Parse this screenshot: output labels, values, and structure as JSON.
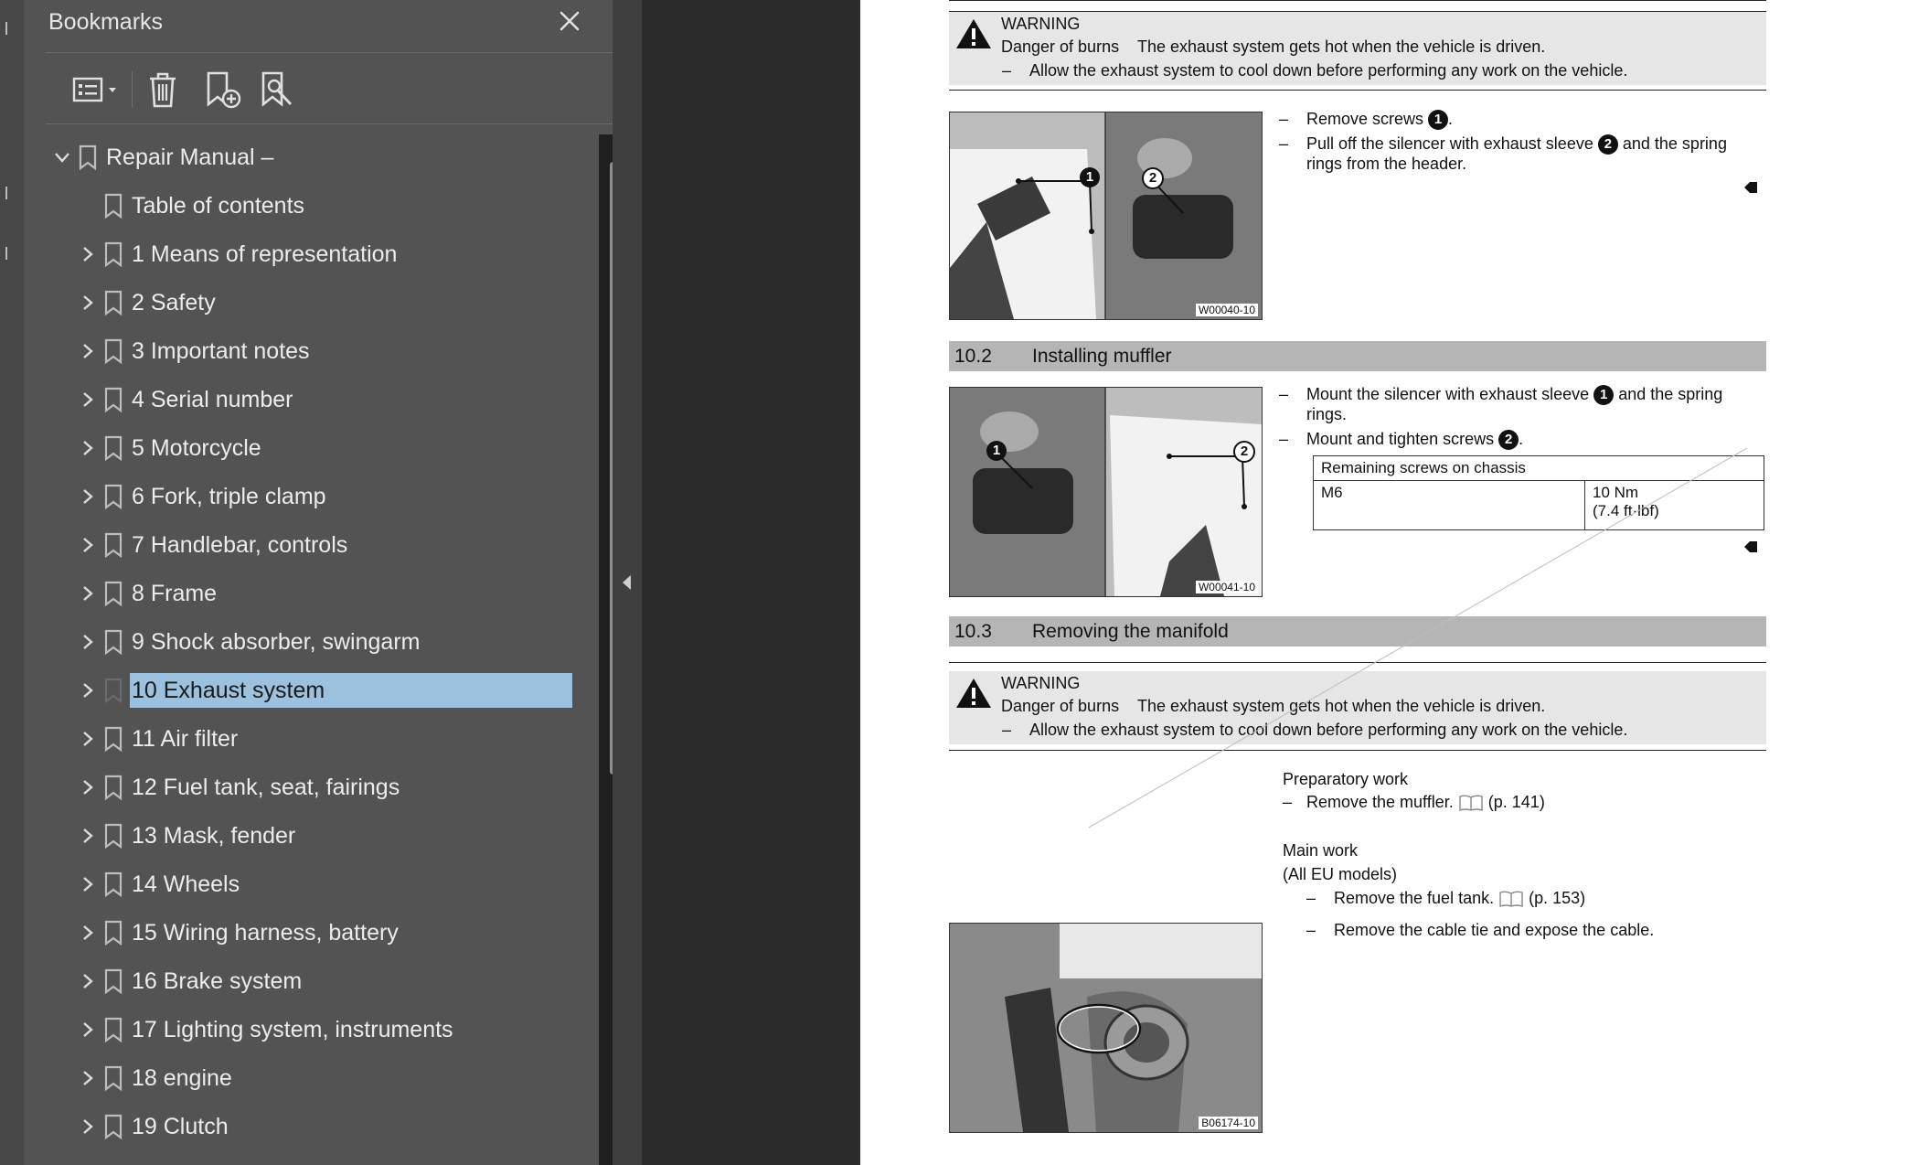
{
  "bookmarks": {
    "title": "Bookmarks",
    "items": [
      {
        "label": "Repair Manual –",
        "expanded": true,
        "level": 0
      },
      {
        "label": "Table of contents",
        "level": 1,
        "leaf": true
      },
      {
        "label": "1 Means of representation",
        "level": 1
      },
      {
        "label": "2 Safety",
        "level": 1
      },
      {
        "label": "3 Important notes",
        "level": 1
      },
      {
        "label": "4 Serial number",
        "level": 1
      },
      {
        "label": "5 Motorcycle",
        "level": 1
      },
      {
        "label": "6 Fork, triple clamp",
        "level": 1
      },
      {
        "label": "7 Handlebar, controls",
        "level": 1
      },
      {
        "label": "8 Frame",
        "level": 1
      },
      {
        "label": "9 Shock absorber, swingarm",
        "level": 1
      },
      {
        "label": "10 Exhaust system",
        "level": 1,
        "selected": true
      },
      {
        "label": "11 Air filter",
        "level": 1
      },
      {
        "label": "12 Fuel tank, seat, fairings",
        "level": 1
      },
      {
        "label": "13 Mask, fender",
        "level": 1
      },
      {
        "label": "14 Wheels",
        "level": 1
      },
      {
        "label": "15 Wiring harness, battery",
        "level": 1
      },
      {
        "label": "16 Brake system",
        "level": 1
      },
      {
        "label": "17 Lighting system, instruments",
        "level": 1
      },
      {
        "label": "18 engine",
        "level": 1
      },
      {
        "label": "19 Clutch",
        "level": 1
      }
    ]
  },
  "page": {
    "warning1": {
      "title": "WARNING",
      "danger_label": "Danger of burns",
      "danger_text": "The exhaust system gets hot when the vehicle is driven.",
      "action": "Allow the exhaust system to cool down before performing any work on the vehicle."
    },
    "removing_steps": {
      "step1": "Remove screws",
      "step2a": "Pull off the silencer with exhaust sleeve",
      "step2b": "and the spring",
      "step2c": "rings from the header."
    },
    "photo1_code": "W00040-10",
    "section_installing": {
      "num": "10.2",
      "title": "Installing muffler"
    },
    "installing_steps": {
      "step1a": "Mount the silencer with exhaust sleeve",
      "step1b": "and the spring",
      "step1c": "rings.",
      "step2": "Mount and tighten screws"
    },
    "torque_table": {
      "header": "Remaining screws on chassis",
      "thread": "M6",
      "value_nm": "10 Nm",
      "value_ftlb": "(7.4 ft·lbf)"
    },
    "photo2_code": "W00041-10",
    "section_manifold": {
      "num": "10.3",
      "title": "Removing the manifold"
    },
    "warning2": {
      "title": "WARNING",
      "danger_label": "Danger of burns",
      "danger_text": "The exhaust system gets hot when the vehicle is driven.",
      "action": "Allow the exhaust system to cool down before performing any work on the vehicle."
    },
    "preparatory": {
      "heading": "Preparatory work",
      "step": "Remove the muffler.",
      "ref": "(p. 141)"
    },
    "main_work": {
      "heading": "Main work",
      "models": "(All EU models)",
      "step1": "Remove the fuel tank.",
      "step1_ref": "(p. 153)",
      "step2": "Remove the cable tie and expose the cable."
    },
    "photo3_code": "B06174-10",
    "callouts": {
      "one": "1",
      "two": "2"
    }
  }
}
